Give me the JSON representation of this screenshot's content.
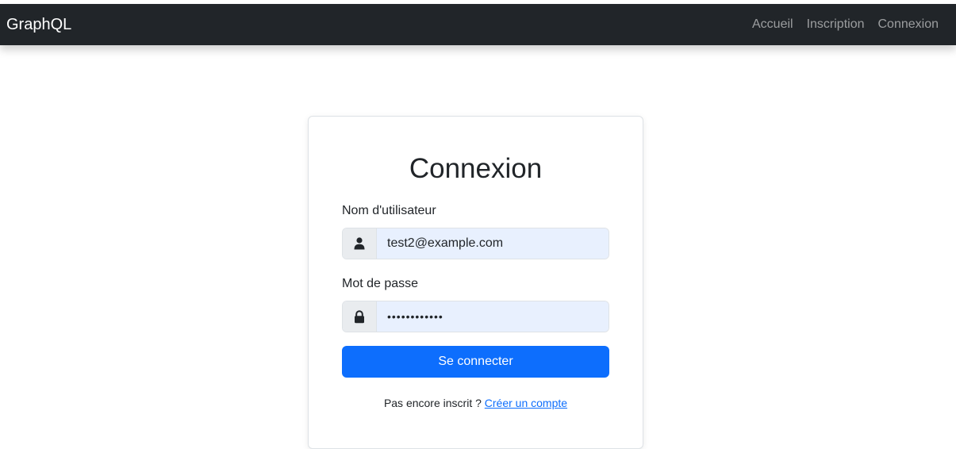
{
  "navbar": {
    "brand": "GraphQL",
    "links": [
      {
        "label": "Accueil"
      },
      {
        "label": "Inscription"
      },
      {
        "label": "Connexion"
      }
    ]
  },
  "login": {
    "title": "Connexion",
    "username": {
      "label": "Nom d'utilisateur",
      "value": "test2@example.com",
      "icon": "user-icon"
    },
    "password": {
      "label": "Mot de passe",
      "value": "123456789012",
      "icon": "lock-icon"
    },
    "submit_label": "Se connecter",
    "footer_text": "Pas encore inscrit ?",
    "footer_link": "Créer un compte"
  },
  "colors": {
    "navbar_bg": "#212529",
    "primary": "#0d6efd",
    "autofill_bg": "#e8f0fe"
  }
}
